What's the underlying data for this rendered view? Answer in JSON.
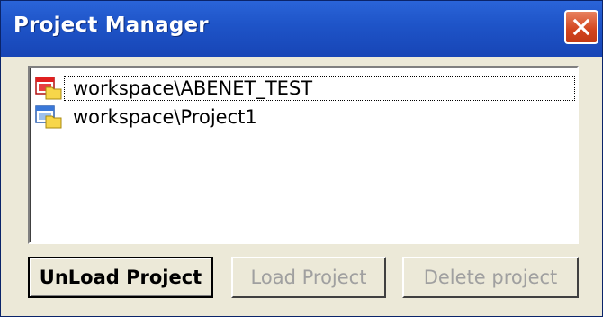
{
  "window": {
    "title": "Project Manager"
  },
  "projects": {
    "items": [
      {
        "label": "workspace\\ABENET_TEST",
        "icon": "project-loaded-icon",
        "selected": true
      },
      {
        "label": "workspace\\Project1",
        "icon": "project-icon",
        "selected": false
      }
    ]
  },
  "buttons": {
    "unload_label": "UnLoad Project",
    "load_label": "Load Project",
    "delete_label": "Delete project"
  },
  "colors": {
    "titlebar": "#1f55c9",
    "close_button": "#d2441d",
    "window_background": "#ece9d8"
  }
}
